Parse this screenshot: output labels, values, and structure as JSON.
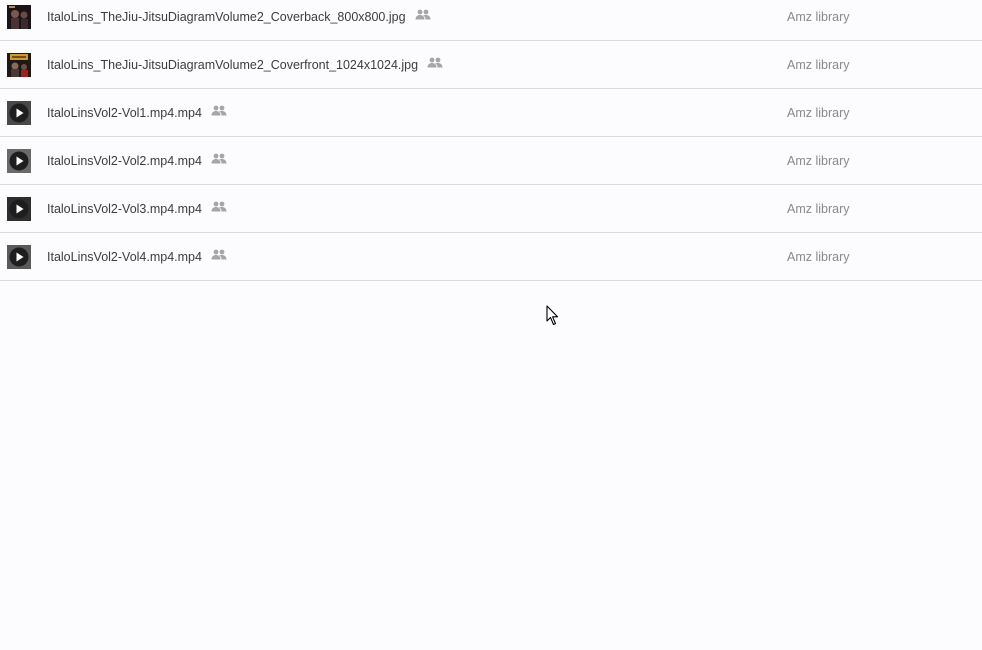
{
  "files": [
    {
      "name": "ItaloLins_TheJiu-JitsuDiagramVolume2_Coverback_800x800.jpg",
      "owner": "Amz library",
      "type": "image",
      "shared_icon": "people-icon"
    },
    {
      "name": "ItaloLins_TheJiu-JitsuDiagramVolume2_Coverfront_1024x1024.jpg",
      "owner": "Amz library",
      "type": "image",
      "shared_icon": "people-icon"
    },
    {
      "name": "ItaloLinsVol2-Vol1.mp4.mp4",
      "owner": "Amz library",
      "type": "video",
      "shared_icon": "people-icon"
    },
    {
      "name": "ItaloLinsVol2-Vol2.mp4.mp4",
      "owner": "Amz library",
      "type": "video",
      "shared_icon": "people-icon"
    },
    {
      "name": "ItaloLinsVol2-Vol3.mp4.mp4",
      "owner": "Amz library",
      "type": "video",
      "shared_icon": "people-icon"
    },
    {
      "name": "ItaloLinsVol2-Vol4.mp4.mp4",
      "owner": "Amz library",
      "type": "video",
      "shared_icon": "people-icon"
    }
  ],
  "colors": {
    "background": "#fcfbfd",
    "divider": "#dadada",
    "filename_text": "#3c3c3c",
    "owner_text": "#8a8a8a",
    "shared_icon": "#a6a6a6"
  }
}
